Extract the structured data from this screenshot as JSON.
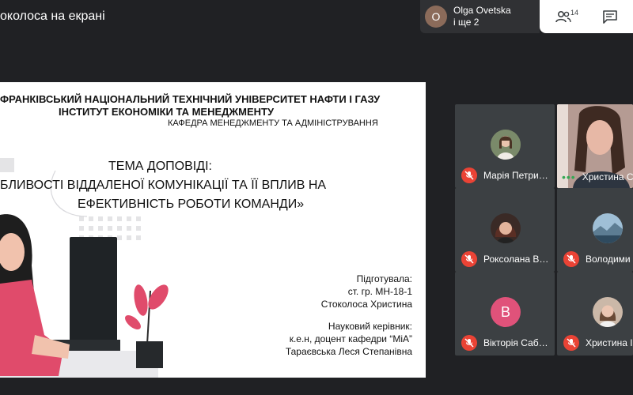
{
  "header": {
    "presenting_title": "околоса на екрані"
  },
  "presenter": {
    "avatar_letter": "O",
    "name": "Olga Ovetska",
    "more": "і ще 2"
  },
  "actions": {
    "people_count": "14",
    "people_icon": "people-icon",
    "chat_icon": "chat-icon"
  },
  "slide": {
    "university": "ФРАНКІВСЬКИЙ НАЦІОНАЛЬНИЙ ТЕХНІЧНИЙ УНІВЕРСИТЕТ НАФТИ І ГАЗУ",
    "institute": "ІНСТИТУТ ЕКОНОМІКИ ТА МЕНЕДЖМЕНТУ",
    "department": "КАФЕДРА МЕНЕДЖМЕНТУ ТА АДМІНІСТРУВАННЯ",
    "topic_heading": "ТЕМА ДОПОВІДІ:",
    "topic_line1": "БЛИВОСТІ ВІДДАЛЕНОЇ КОМУНІКАЦІЇ ТА ЇЇ ВПЛИВ НА",
    "topic_line2": "ЕФЕКТИВНІСТЬ РОБОТИ КОМАНДИ»",
    "prepared_label": "Підготувала:",
    "group": "ст. гр. МН-18-1",
    "author": "Стоколоса Христина",
    "advisor_label": "Науковий керівник:",
    "advisor_title": "к.е.н, доцент кафедри “МіА”",
    "advisor_name": "Тараєвська Леся Степанівна"
  },
  "participants": [
    {
      "name": "Марія Петри…",
      "muted": true
    },
    {
      "name": "Христина С",
      "muted": false
    },
    {
      "name": "Роксолана В…",
      "muted": true
    },
    {
      "name": "Володими",
      "muted": true
    },
    {
      "name": "Вікторія Саб…",
      "muted": true,
      "avatar_letter": "В"
    },
    {
      "name": "Христина І",
      "muted": true
    }
  ],
  "colors": {
    "accent_red": "#ea4335",
    "speaking_green": "#34a853",
    "avatar_pink": "#e0527a"
  }
}
